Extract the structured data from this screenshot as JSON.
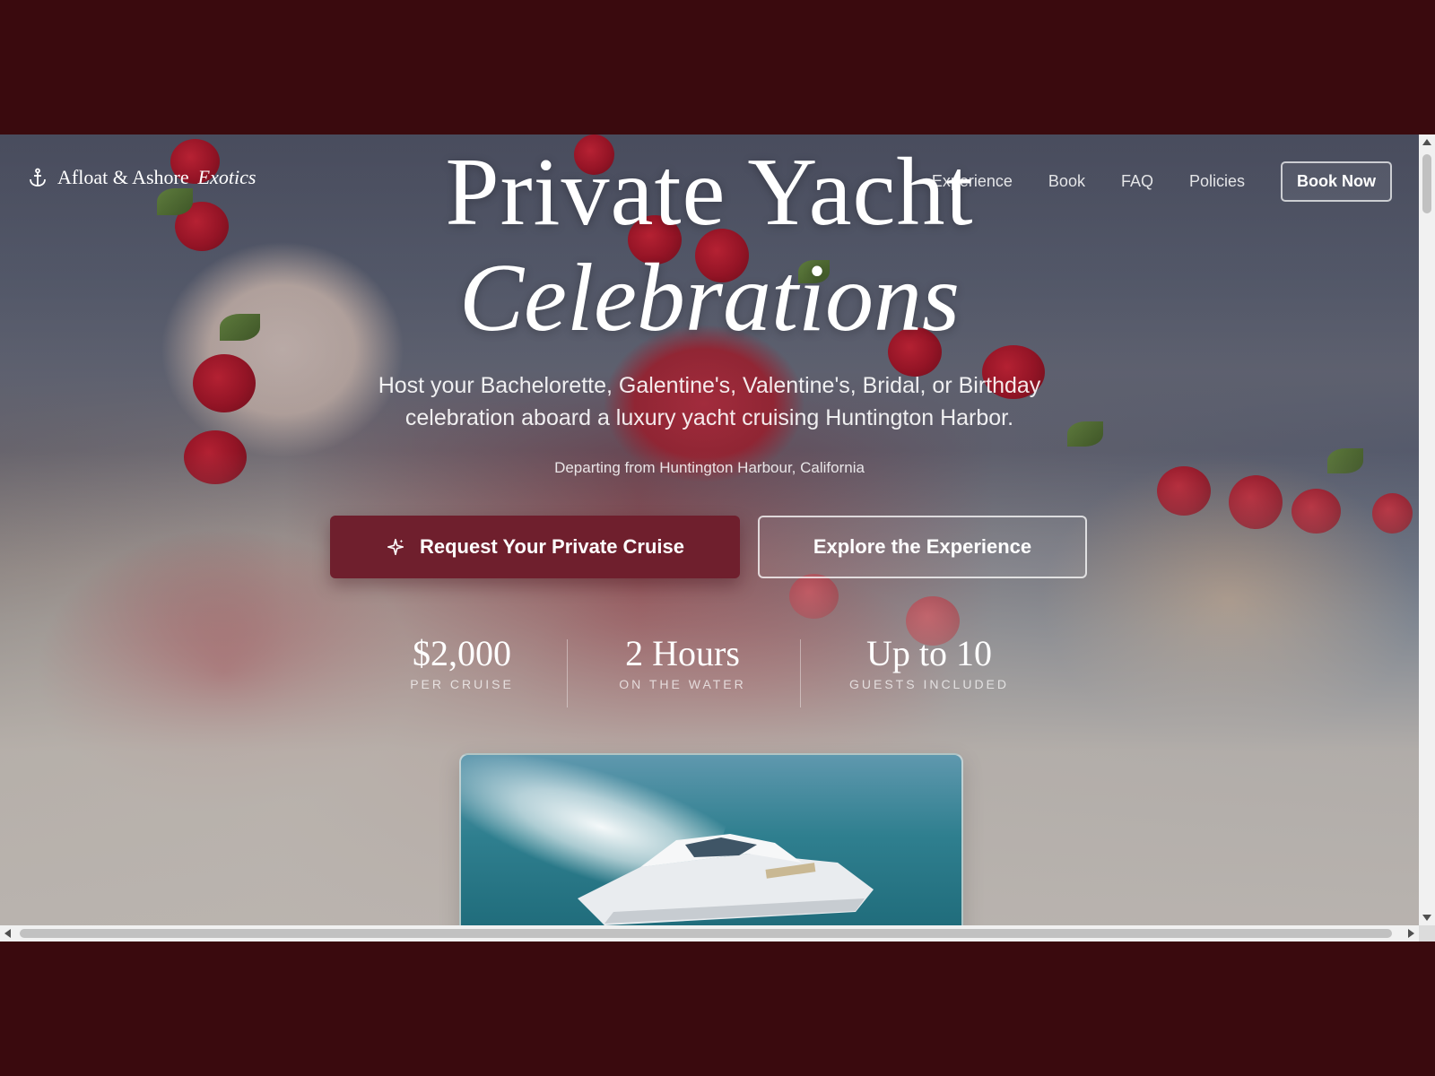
{
  "brand": {
    "name": "Afloat & Ashore",
    "accent": "Exotics",
    "icon": "anchor-icon"
  },
  "nav": {
    "links": [
      "Experience",
      "Book",
      "FAQ",
      "Policies"
    ],
    "cta": "Book Now"
  },
  "hero": {
    "headline_line1": "Private Yacht",
    "headline_line2": "Celebrations",
    "subtitle": "Host your Bachelorette, Galentine's, Valentine's, Bridal, or Birthday celebration aboard a luxury yacht cruising Huntington Harbor.",
    "departing": "Departing from Huntington Harbour, California",
    "primary_button": "Request Your Private Cruise",
    "primary_icon": "sparkle-icon",
    "secondary_button": "Explore the Experience"
  },
  "stats": [
    {
      "value": "$2,000",
      "label": "PER CRUISE"
    },
    {
      "value": "2 Hours",
      "label": "ON THE WATER"
    },
    {
      "value": "Up to 10",
      "label": "GUESTS INCLUDED"
    }
  ],
  "colors": {
    "brand_burgundy": "#6f1f2d",
    "page_frame": "#3a0a0e",
    "text_light": "#ffffff"
  }
}
